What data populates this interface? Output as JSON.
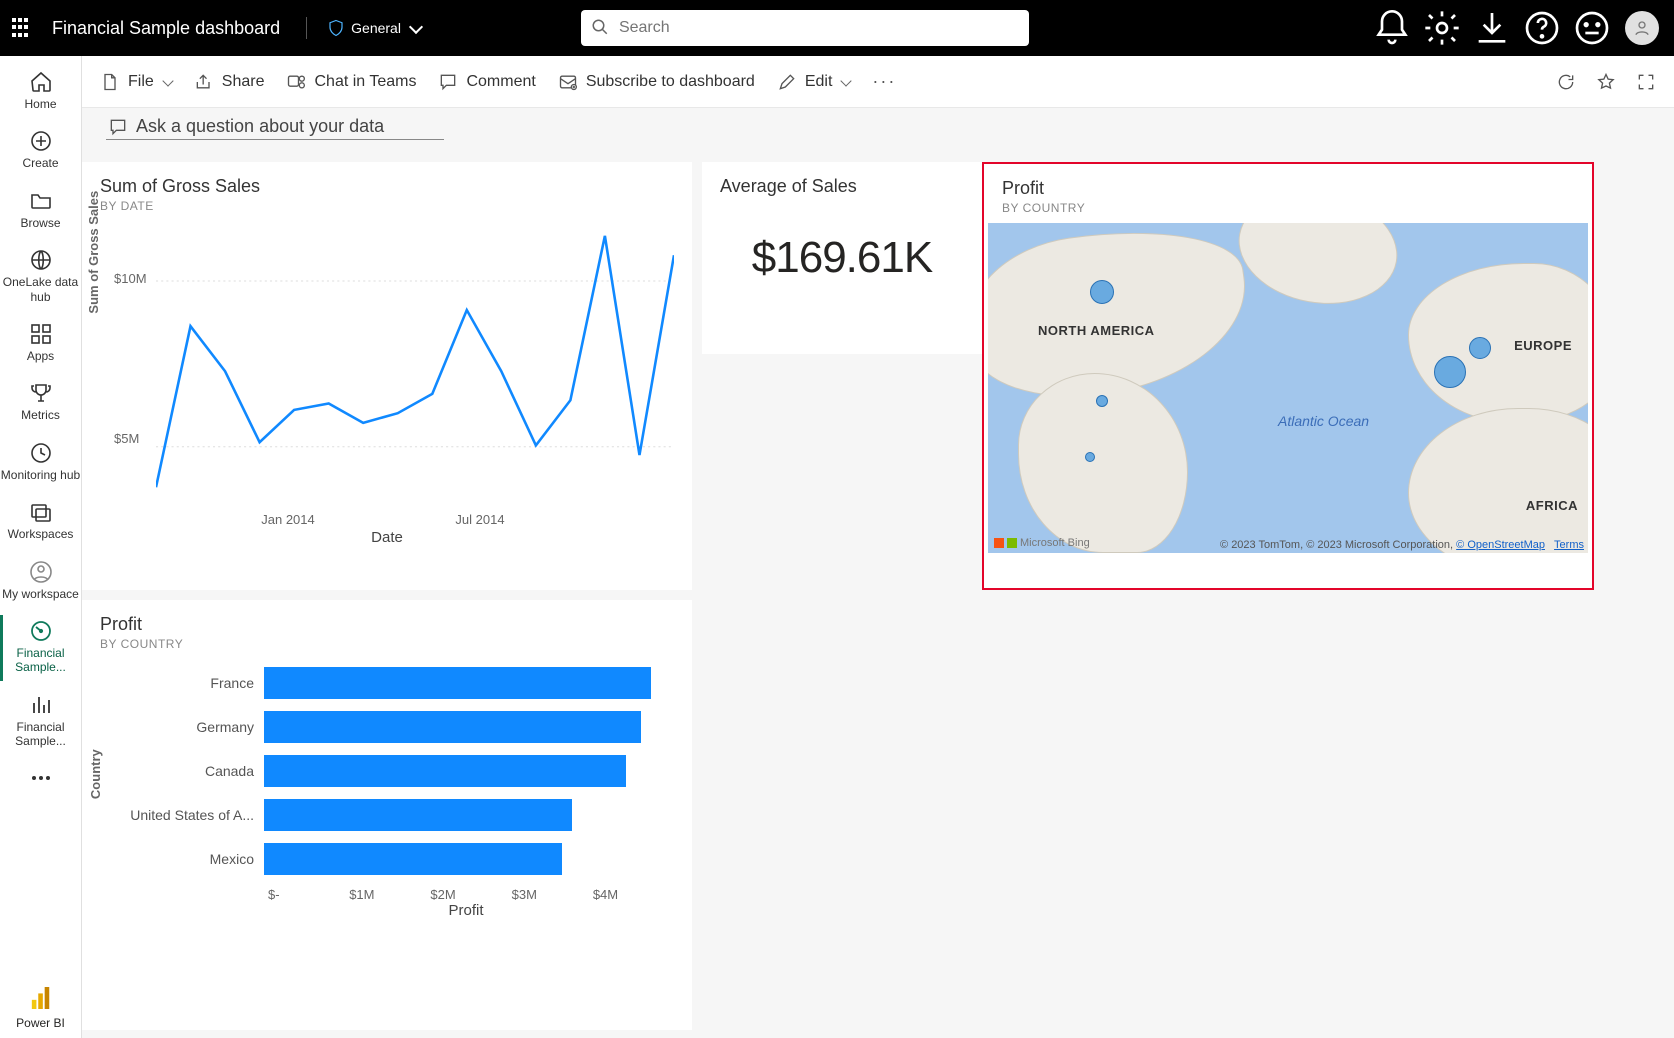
{
  "header": {
    "title": "Financial Sample  dashboard",
    "sensitivity": "General",
    "search_placeholder": "Search"
  },
  "leftrail": {
    "items": [
      {
        "label": "Home",
        "icon": "home"
      },
      {
        "label": "Create",
        "icon": "plus"
      },
      {
        "label": "Browse",
        "icon": "folder"
      },
      {
        "label": "OneLake data hub",
        "icon": "onelake"
      },
      {
        "label": "Apps",
        "icon": "apps"
      },
      {
        "label": "Metrics",
        "icon": "trophy"
      },
      {
        "label": "Monitoring hub",
        "icon": "monitor"
      },
      {
        "label": "Workspaces",
        "icon": "workspaces"
      },
      {
        "label": "My workspace",
        "icon": "person"
      },
      {
        "label": "Financial Sample...",
        "icon": "gauge",
        "active": true
      },
      {
        "label": "Financial Sample...",
        "icon": "bars"
      }
    ],
    "footer": "Power BI"
  },
  "cmdbar": {
    "file": "File",
    "share": "Share",
    "chat": "Chat in Teams",
    "comment": "Comment",
    "subscribe": "Subscribe to dashboard",
    "edit": "Edit"
  },
  "qna": "Ask a question about your data",
  "tiles": {
    "line": {
      "title": "Sum of Gross Sales",
      "sub": "BY DATE",
      "xlabel": "Date",
      "ylabel": "Sum of Gross Sales"
    },
    "avg": {
      "title": "Average of Sales",
      "value": "$169.61K"
    },
    "map": {
      "title": "Profit",
      "sub": "BY COUNTRY",
      "na": "NORTH AMERICA",
      "eu": "EUROPE",
      "af": "AFRICA",
      "ocean": "Atlantic Ocean",
      "bing": "Microsoft Bing",
      "attr_prefix": "© 2023 TomTom, © 2023 Microsoft Corporation, ",
      "attr_link": "© OpenStreetMap",
      "attr_suffix": "Terms"
    },
    "bar": {
      "title": "Profit",
      "sub": "BY COUNTRY",
      "xlabel": "Profit",
      "ylabel": "Country"
    }
  },
  "chart_data": [
    {
      "id": "line",
      "type": "line",
      "title": "Sum of Gross Sales by Date",
      "ylabel": "Sum of Gross Sales",
      "xlabel": "Date",
      "yticks": [
        {
          "v": 5000000,
          "label": "$5M"
        },
        {
          "v": 10000000,
          "label": "$10M"
        }
      ],
      "xticks": [
        "Jan 2014",
        "Jul 2014"
      ],
      "ylim": [
        4000000,
        13000000
      ],
      "x": [
        "Sep 2013",
        "Oct 2013",
        "Nov 2013",
        "Dec 2013",
        "Jan 2014",
        "Feb 2014",
        "Mar 2014",
        "Apr 2014",
        "May 2014",
        "Jun 2014",
        "Jul 2014",
        "Aug 2014",
        "Sep 2014",
        "Oct 2014",
        "Nov 2014",
        "Dec 2014"
      ],
      "values": [
        4800000,
        9800000,
        8400000,
        6200000,
        7200000,
        7400000,
        6800000,
        7100000,
        7700000,
        10300000,
        8400000,
        6100000,
        7500000,
        12600000,
        5800000,
        12000000
      ]
    },
    {
      "id": "bar",
      "type": "bar",
      "orientation": "horizontal",
      "title": "Profit by Country",
      "ylabel": "Country",
      "xlabel": "Profit",
      "xlim": [
        0,
        4000000
      ],
      "xticks": [
        {
          "v": 0,
          "label": "$-"
        },
        {
          "v": 1000000,
          "label": "$1M"
        },
        {
          "v": 2000000,
          "label": "$2M"
        },
        {
          "v": 3000000,
          "label": "$3M"
        },
        {
          "v": 4000000,
          "label": "$4M"
        }
      ],
      "categories": [
        "France",
        "Germany",
        "Canada",
        "United States of A...",
        "Mexico"
      ],
      "values": [
        3780000,
        3680000,
        3530000,
        3000000,
        2910000
      ]
    },
    {
      "id": "map",
      "type": "map",
      "title": "Profit by Country",
      "bubbles": [
        {
          "country": "Canada",
          "x_pct": 19,
          "y_pct": 21,
          "r": 12
        },
        {
          "country": "United States",
          "x_pct": 19,
          "y_pct": 54,
          "r": 6
        },
        {
          "country": "Mexico",
          "x_pct": 17,
          "y_pct": 71,
          "r": 5
        },
        {
          "country": "Germany",
          "x_pct": 77,
          "y_pct": 45,
          "r": 16
        },
        {
          "country": "France",
          "x_pct": 82,
          "y_pct": 38,
          "r": 11
        }
      ]
    }
  ]
}
